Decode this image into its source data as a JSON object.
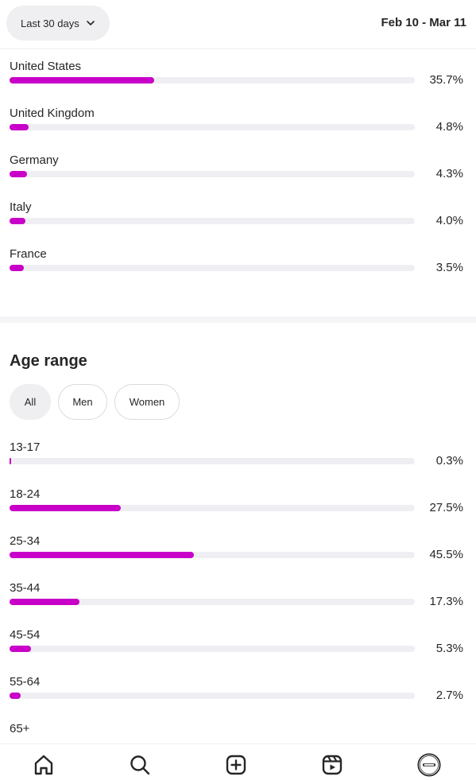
{
  "header": {
    "period_label": "Last 30 days",
    "date_range": "Feb 10 - Mar 11"
  },
  "locations": {
    "items": [
      {
        "label": "United States",
        "value": "35.7%"
      },
      {
        "label": "United Kingdom",
        "value": "4.8%"
      },
      {
        "label": "Germany",
        "value": "4.3%"
      },
      {
        "label": "Italy",
        "value": "4.0%"
      },
      {
        "label": "France",
        "value": "3.5%"
      }
    ]
  },
  "age_range": {
    "title": "Age range",
    "filters": [
      {
        "label": "All",
        "active": true
      },
      {
        "label": "Men",
        "active": false
      },
      {
        "label": "Women",
        "active": false
      }
    ],
    "items": [
      {
        "label": "13-17",
        "value": "0.3%"
      },
      {
        "label": "18-24",
        "value": "27.5%"
      },
      {
        "label": "25-34",
        "value": "45.5%"
      },
      {
        "label": "35-44",
        "value": "17.3%"
      },
      {
        "label": "45-54",
        "value": "5.3%"
      },
      {
        "label": "55-64",
        "value": "2.7%"
      },
      {
        "label": "65+",
        "value": ""
      }
    ]
  },
  "bar_color": "#c800c8",
  "bottom_nav": {
    "items": [
      {
        "icon": "home-icon",
        "notification_dot": true
      },
      {
        "icon": "search-icon"
      },
      {
        "icon": "create-icon"
      },
      {
        "icon": "reels-icon"
      },
      {
        "icon": "profile-avatar-icon"
      }
    ]
  }
}
